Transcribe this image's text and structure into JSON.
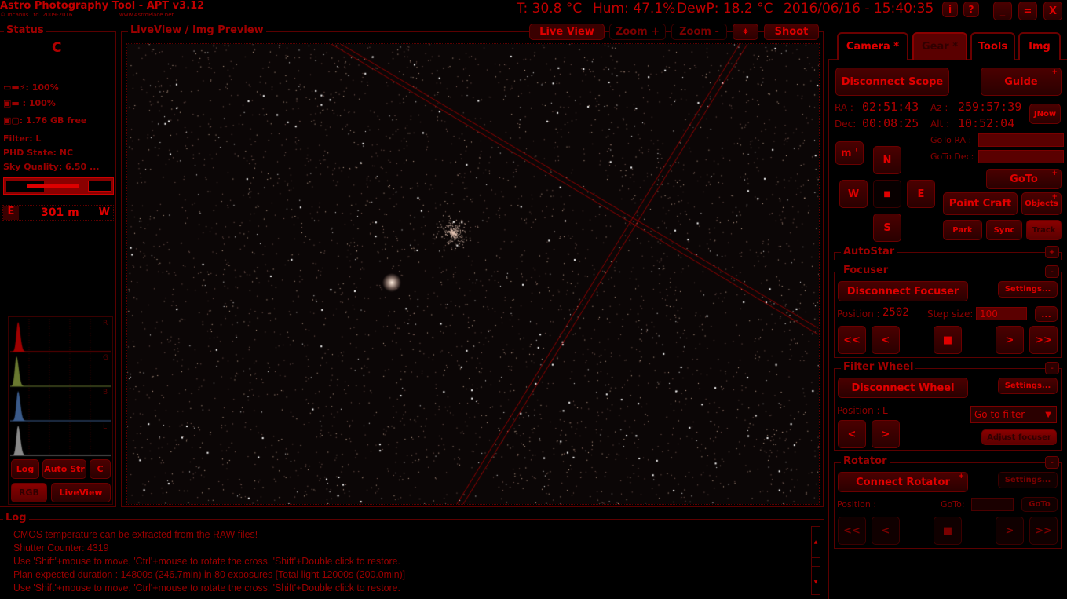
{
  "app": {
    "title": "Astro Photography Tool - APT v3.12",
    "copyright": "© Incanus Ltd. 2009-2016",
    "website": "www.AstroPlace.net"
  },
  "header": {
    "temperature": "T: 30.8 °C",
    "humidity": "Hum: 47.1%",
    "dewpoint": "DewP: 18.2 °C",
    "datetime": "2016/06/16 - 15:40:35",
    "info": "i",
    "help": "?",
    "minimize": "_",
    "maximize": "=",
    "close": "X"
  },
  "status": {
    "title": "Status",
    "mode": "C",
    "battery_pc": ": 100%",
    "battery_cam": ": 100%",
    "storage": ": 1.76 GB free",
    "filter": "Filter: L",
    "phd": "PHD State: NC",
    "sky": "Sky Quality: 6.50 ...",
    "east": "E",
    "west": "W",
    "distance": "301 m"
  },
  "histogram": {
    "channels": [
      "R",
      "G",
      "B",
      "L"
    ],
    "colors": [
      "#a00000",
      "#6a7a30",
      "#3a5a8a",
      "#8a8a8a"
    ],
    "log": "Log",
    "auto_str": "Auto Str",
    "c": "C",
    "rgb": "RGB",
    "liveview": "LiveView"
  },
  "preview": {
    "title": "LiveView / Img Preview",
    "live_view": "Live View",
    "zoom_in": "Zoom +",
    "zoom_out": "Zoom -",
    "shoot": "Shoot"
  },
  "tabs": [
    {
      "label": "Camera *"
    },
    {
      "label": "Gear *",
      "active": true
    },
    {
      "label": "Tools"
    },
    {
      "label": "Img"
    }
  ],
  "scope": {
    "disconnect": "Disconnect Scope",
    "guide": "Guide",
    "ra_label": "RA :",
    "ra": "02:51:43",
    "dec_label": "Dec:",
    "dec": "00:08:25",
    "az_label": "Az :",
    "az": "259:57:39",
    "alt_label": "Alt :",
    "alt": "10:52:04",
    "jnow": "JNow",
    "goto_ra": "GoTo RA  :",
    "goto_dec": "GoTo Dec:",
    "goto_ra_value": "",
    "goto_dec_value": "",
    "m": "m '",
    "n": "N",
    "w": "W",
    "e": "E",
    "s": "S",
    "goto": "GoTo",
    "point_craft": "Point Craft",
    "objects": "Objects",
    "park": "Park",
    "sync": "Sync",
    "track": "Track"
  },
  "autostar": {
    "title": "AutoStar",
    "toggle": "+"
  },
  "focuser": {
    "title": "Focuser",
    "toggle": "-",
    "disconnect": "Disconnect Focuser",
    "settings": "Settings...",
    "position_label": "Position :",
    "position": "2502",
    "step_label": "Step size:",
    "step": "100",
    "more": "...",
    "fast_in": "<<",
    "in": "<",
    "stop": "■",
    "out": ">",
    "fast_out": ">>"
  },
  "filter_wheel": {
    "title": "Filter Wheel",
    "toggle": "-",
    "disconnect": "Disconnect Wheel",
    "settings": "Settings...",
    "position_label": "Position :",
    "position": "L",
    "goto_filter": "Go to filter",
    "prev": "<",
    "next": ">",
    "adjust": "Adjust focuser"
  },
  "rotator": {
    "title": "Rotator",
    "toggle": "-",
    "connect": "Connect Rotator",
    "settings": "Settings...",
    "position_label": "Position :",
    "goto_label": "GoTo:",
    "goto_value": "",
    "goto": "GoTo",
    "fast_ccw": "<<",
    "ccw": "<",
    "stop": "■",
    "cw": ">",
    "fast_cw": ">>"
  },
  "log": {
    "title": "Log",
    "lines": [
      "CMOS temperature can be extracted from the RAW files!",
      "Shutter Counter: 4319",
      "Use 'Shift'+mouse to move, 'Ctrl'+mouse to rotate the cross, 'Shift'+Double click to restore.",
      "Plan expected duration : 14800s (246.7min) in 80 exposures [Total light 12000s (200.0min)]",
      "Use 'Shift'+mouse to move, 'Ctrl'+mouse to rotate the cross, 'Shift'+Double click to restore."
    ]
  }
}
